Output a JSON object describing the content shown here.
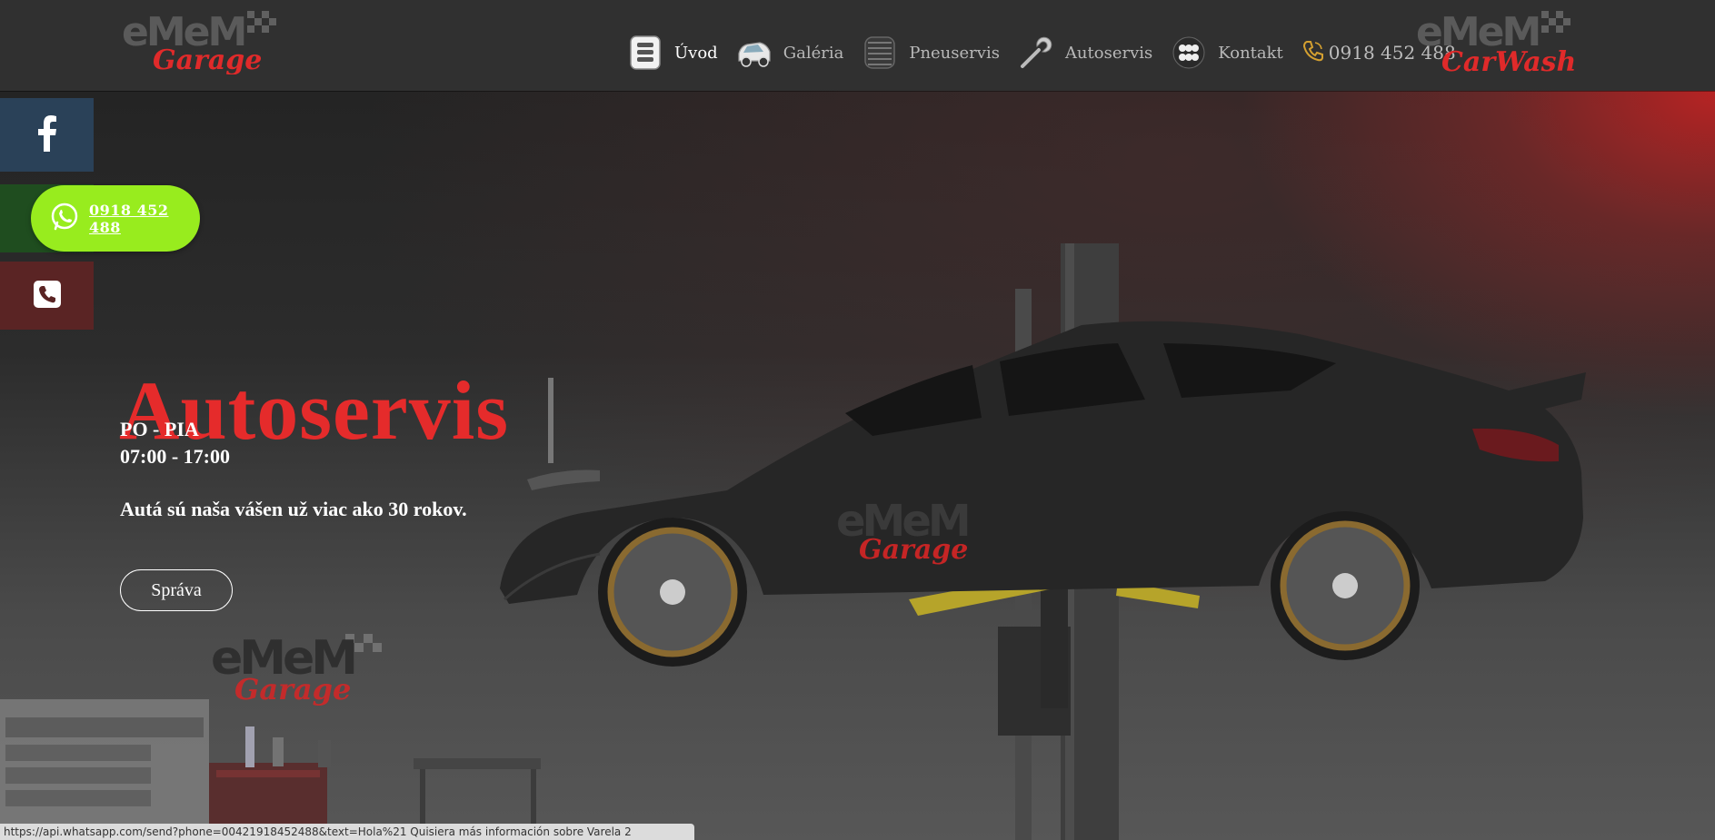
{
  "header": {
    "logo_left": {
      "top_text": "eMeM",
      "bottom_text": "Garage"
    },
    "logo_right": {
      "top_text": "eMeM",
      "bottom_text": "CarWash"
    },
    "nav": [
      {
        "label": "Úvod",
        "icon": "document-icon",
        "active": true
      },
      {
        "label": "Galéria",
        "icon": "car-icon",
        "active": false
      },
      {
        "label": "Pneuservis",
        "icon": "tire-icon",
        "active": false
      },
      {
        "label": "Autoservis",
        "icon": "wrench-icon",
        "active": false
      },
      {
        "label": "Kontakt",
        "icon": "contact-icon",
        "active": false
      }
    ],
    "phone": "0918 452 488"
  },
  "sidebar": {
    "facebook_icon": "facebook-icon",
    "whatsapp_number": "0918 452 488",
    "phone_icon": "phone-icon"
  },
  "hero": {
    "title": "Autoservis",
    "days": "PO - PIA",
    "hours": "07:00 - 17:00",
    "tagline": "Autá sú naša vášen už viac ako 30 rokov.",
    "button_label": "Správa",
    "watermark_logo": {
      "top_text": "eMeM",
      "bottom_text": "Garage"
    }
  },
  "status_bar": {
    "url": "https://api.whatsapp.com/send?phone=00421918452488&text=Hola%21 Quisiera más información sobre Varela 2"
  },
  "colors": {
    "accent_red": "#e52b2b",
    "header_bg": "#303030",
    "whatsapp_green": "#98ec1e",
    "facebook_blue": "#2a4158"
  }
}
